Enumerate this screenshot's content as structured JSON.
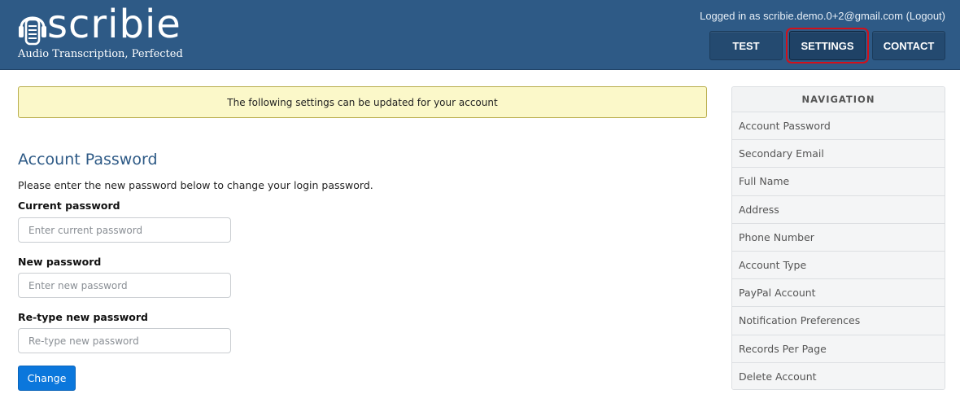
{
  "brand": {
    "logo_icon": "headphone-microphone-icon",
    "name": "scribie",
    "tagline": "Audio Transcription, Perfected"
  },
  "header": {
    "login_text": "Logged in as scribie.demo.0+2@gmail.com",
    "logout_label": "(Logout)",
    "nav": {
      "test": "TEST",
      "settings": "SETTINGS",
      "contact": "CONTACT"
    }
  },
  "notice": {
    "text": "The following settings can be updated for your account"
  },
  "form": {
    "title": "Account Password",
    "description": "Please enter the new password below to change your login password.",
    "current": {
      "label": "Current password",
      "placeholder": "Enter current password",
      "value": ""
    },
    "new": {
      "label": "New password",
      "placeholder": "Enter new password",
      "value": ""
    },
    "retype": {
      "label": "Re-type new password",
      "placeholder": "Re-type new password",
      "value": ""
    },
    "submit_label": "Change"
  },
  "sidebar": {
    "heading": "NAVIGATION",
    "items": [
      "Account Password",
      "Secondary Email",
      "Full Name",
      "Address",
      "Phone Number",
      "Account Type",
      "PayPal Account",
      "Notification Preferences",
      "Records Per Page",
      "Delete Account"
    ]
  },
  "colors": {
    "header_bg": "#2e5a86",
    "notice_bg": "#fbf8c9",
    "primary_button": "#0b77dc",
    "highlight_outline": "#d2101a"
  }
}
